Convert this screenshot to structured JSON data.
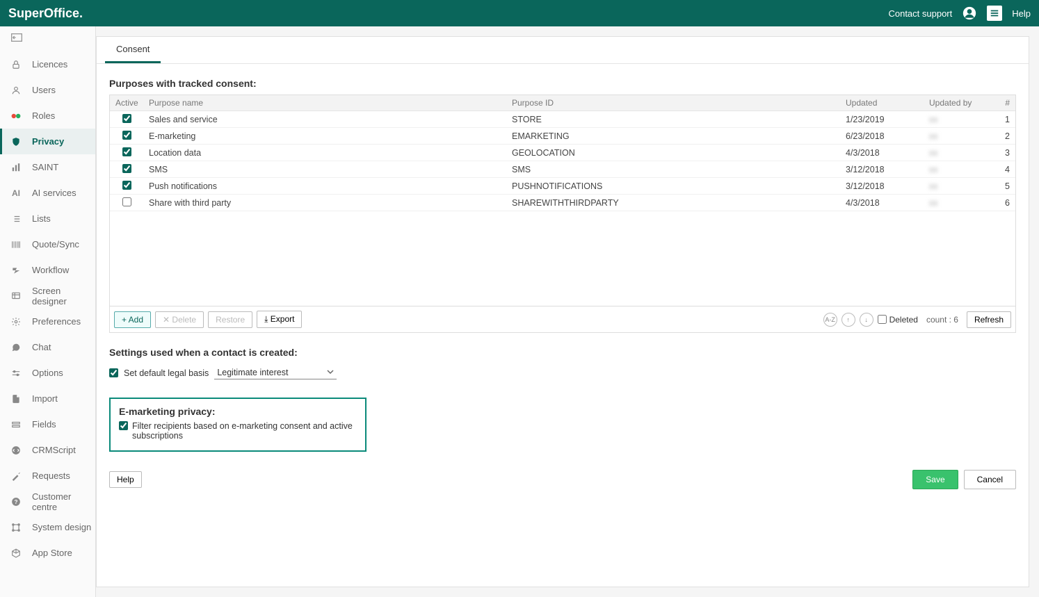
{
  "header": {
    "brand": "SuperOffice.",
    "contact_support": "Contact support",
    "help": "Help"
  },
  "sidebar": {
    "items": [
      {
        "label": "Licences",
        "icon": "lock"
      },
      {
        "label": "Users",
        "icon": "user"
      },
      {
        "label": "Roles",
        "icon": "roles"
      },
      {
        "label": "Privacy",
        "icon": "shield",
        "active": true
      },
      {
        "label": "SAINT",
        "icon": "bars"
      },
      {
        "label": "AI services",
        "icon": "ai"
      },
      {
        "label": "Lists",
        "icon": "list"
      },
      {
        "label": "Quote/Sync",
        "icon": "barcode"
      },
      {
        "label": "Workflow",
        "icon": "flow"
      },
      {
        "label": "Screen designer",
        "icon": "screen"
      },
      {
        "label": "Preferences",
        "icon": "gear"
      },
      {
        "label": "Chat",
        "icon": "chat"
      },
      {
        "label": "Options",
        "icon": "options"
      },
      {
        "label": "Import",
        "icon": "import"
      },
      {
        "label": "Fields",
        "icon": "fields"
      },
      {
        "label": "CRMScript",
        "icon": "code"
      },
      {
        "label": "Requests",
        "icon": "wand"
      },
      {
        "label": "Customer centre",
        "icon": "help"
      },
      {
        "label": "System design",
        "icon": "design"
      },
      {
        "label": "App Store",
        "icon": "store"
      }
    ]
  },
  "tabs": {
    "active": "Consent"
  },
  "purposes": {
    "title": "Purposes with tracked consent:",
    "columns": {
      "active": "Active",
      "name": "Purpose name",
      "id": "Purpose ID",
      "updated": "Updated",
      "by": "Updated by",
      "hash": "#"
    },
    "rows": [
      {
        "checked": true,
        "name": "Sales and service",
        "id": "STORE",
        "updated": "1/23/2019",
        "by": "",
        "hash": "1"
      },
      {
        "checked": true,
        "name": "E-marketing",
        "id": "EMARKETING",
        "updated": "6/23/2018",
        "by": "",
        "hash": "2"
      },
      {
        "checked": true,
        "name": "Location data",
        "id": "GEOLOCATION",
        "updated": "4/3/2018",
        "by": "",
        "hash": "3"
      },
      {
        "checked": true,
        "name": "SMS",
        "id": "SMS",
        "updated": "3/12/2018",
        "by": "",
        "hash": "4"
      },
      {
        "checked": true,
        "name": "Push notifications",
        "id": "PUSHNOTIFICATIONS",
        "updated": "3/12/2018",
        "by": "",
        "hash": "5"
      },
      {
        "checked": false,
        "name": "Share with third party",
        "id": "SHAREWITHTHIRDPARTY",
        "updated": "4/3/2018",
        "by": "",
        "hash": "6"
      }
    ]
  },
  "toolbar": {
    "add": "+ Add",
    "delete": "✕ Delete",
    "restore": "Restore",
    "export": "⤓ Export",
    "az": "A-Z",
    "deleted": "Deleted",
    "count_label": "count : 6",
    "refresh": "Refresh"
  },
  "settings": {
    "title": "Settings used when a contact is created:",
    "default_legal_basis_label": "Set default legal basis",
    "default_legal_basis_value": "Legitimate interest"
  },
  "emarketing": {
    "title": "E-marketing privacy:",
    "filter_label": "Filter recipients based on e-marketing consent and active subscriptions"
  },
  "footer": {
    "help": "Help",
    "save": "Save",
    "cancel": "Cancel"
  }
}
